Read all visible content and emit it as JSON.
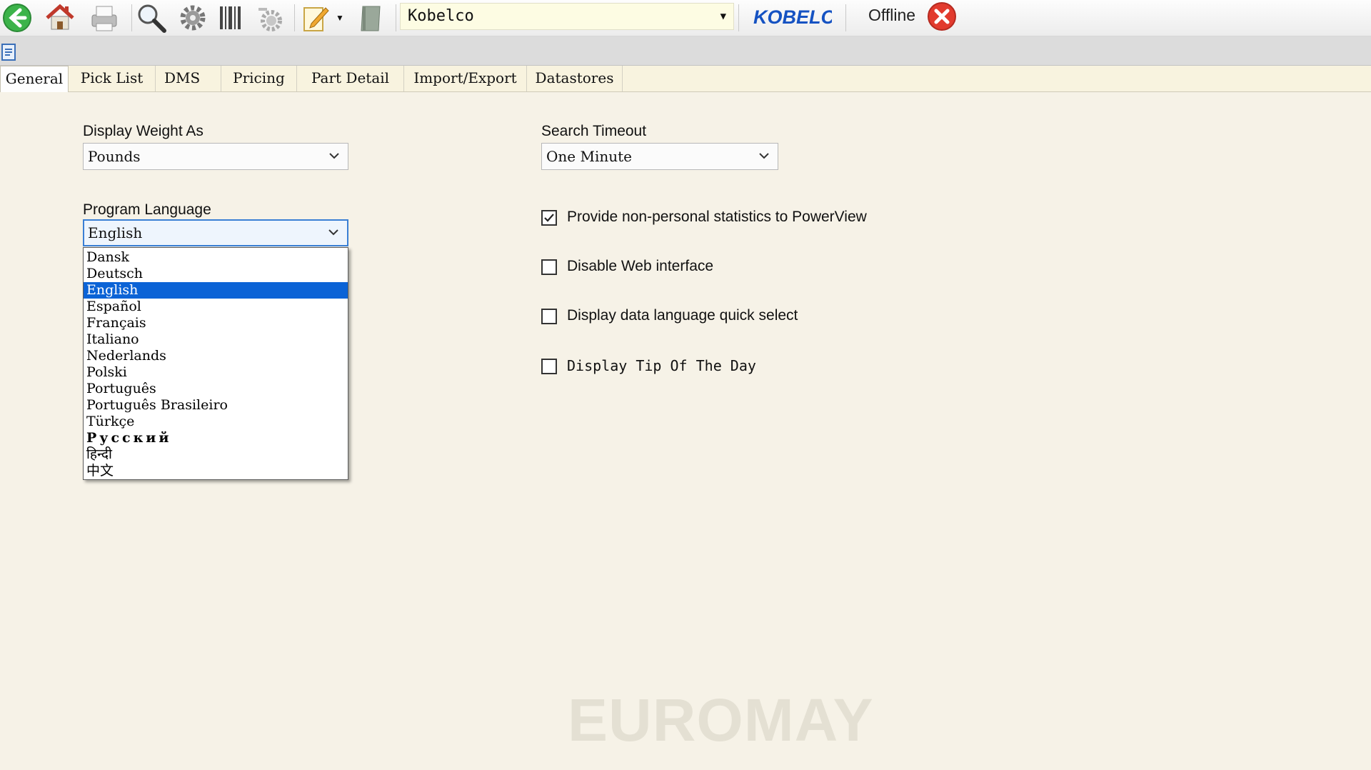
{
  "toolbar": {
    "icons": [
      "back-arrow-icon",
      "home-icon",
      "print-icon",
      "search-icon",
      "gear-icon",
      "barcode-icon",
      "settings-icon",
      "notepad-icon",
      "book-icon"
    ],
    "database_select": "Kobelco",
    "brand_logo": "KOBELCO",
    "status": "Offline",
    "colors": {
      "back": "#3cb34a",
      "offline": "#e23b2e",
      "brand": "#1552c2"
    }
  },
  "tabs": [
    "General",
    "Pick List",
    "DMS",
    "Pricing",
    "Part Detail",
    "Import/Export",
    "Datastores"
  ],
  "active_tab": "General",
  "general": {
    "display_weight": {
      "label": "Display Weight As",
      "value": "Pounds"
    },
    "program_language": {
      "label": "Program Language",
      "value": "English",
      "options": [
        "Dansk",
        "Deutsch",
        "English",
        "Español",
        "Français",
        "Italiano",
        "Nederlands",
        "Polski",
        "Português",
        "Português Brasileiro",
        "Türkçe",
        "Русский",
        "हिन्दी",
        "中文"
      ],
      "selected_index": 2
    },
    "search_timeout": {
      "label": "Search Timeout",
      "value": "One Minute"
    },
    "checkboxes": [
      {
        "label": "Provide non-personal statistics to PowerView",
        "checked": true
      },
      {
        "label": "Disable Web interface",
        "checked": false
      },
      {
        "label": "Display data language quick select",
        "checked": false
      },
      {
        "label": "Display Tip Of The Day",
        "checked": false
      }
    ]
  },
  "watermark": "EUROMAY"
}
